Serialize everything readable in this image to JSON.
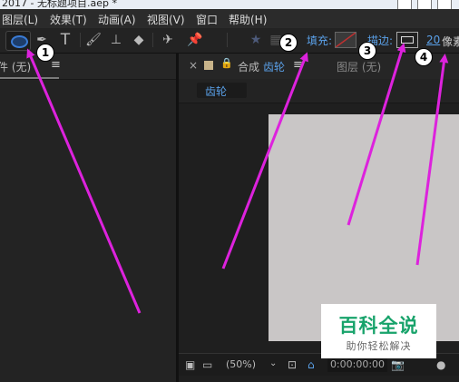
{
  "title_bar": {
    "text": "2017 - 无标题项目.aep *"
  },
  "menubar": {
    "items": [
      "图层(L)",
      "效果(T)",
      "动画(A)",
      "视图(V)",
      "窗口",
      "帮助(H)"
    ]
  },
  "toolbar": {
    "fill_label": "填充:",
    "stroke_label": "描边:",
    "stroke_width": "20",
    "stroke_unit": "像素",
    "tool_icons": [
      "ellipse-icon",
      "pen-icon",
      "text-icon",
      "brush-icon",
      "clone-stamp-icon",
      "eraser-icon",
      "roto-brush-icon",
      "puppet-pin-icon"
    ]
  },
  "left_panel": {
    "tab_label": "件 (无)",
    "menu_glyph": "≡"
  },
  "composition_panel": {
    "close_glyph": "×",
    "lock_glyph": "🔒",
    "tab_prefix": "合成",
    "comp_name": "齿轮",
    "menu_glyph": "≡",
    "layer_label": "图层 (无)",
    "sub_tab": "齿轮",
    "zoom": "(50%)",
    "timecode": "0:00:00:00"
  },
  "annotations": {
    "badges": [
      "1",
      "2",
      "3",
      "4"
    ],
    "color": "#dd22dd"
  },
  "watermark": {
    "title": "百科全说",
    "subtitle": "助你轻松解决"
  },
  "colors": {
    "accent_blue": "#5aa0e8",
    "panel_bg": "#232323",
    "canvas_bg": "#c9c6c6",
    "watermark_green": "#18a36b"
  }
}
